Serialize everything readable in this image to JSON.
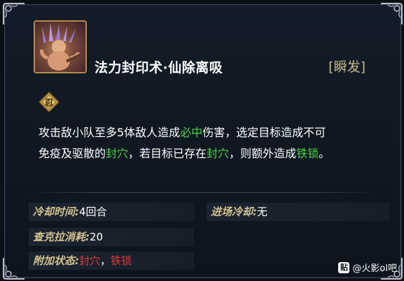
{
  "skill": {
    "name": "法力封印术·仙除离吸",
    "cast_type": "[瞬发]",
    "description": {
      "line1_pre": "攻击敌小队至多5体敌人造成",
      "line1_hl": "必中",
      "line1_post": "伤害，选定目标造成不可",
      "line2_pre": "免疫及驱散的",
      "line2_hl1": "封穴",
      "line2_mid": "，若目标已存在",
      "line2_hl2": "封穴",
      "line2_mid2": "，则额外造成",
      "line2_hl3": "铁锁",
      "line2_post": "。"
    }
  },
  "stats": {
    "cooldown": {
      "label": "冷却时间:",
      "value": "4回合"
    },
    "entry_cooldown": {
      "label": "进场冷却:",
      "value": "无"
    },
    "chakra_cost": {
      "label": "查克拉消耗:",
      "value": "20"
    },
    "extra_status": {
      "label": "附加状态:",
      "value1": "封穴",
      "sep": "，",
      "value2": "铁锁"
    }
  },
  "watermark": {
    "icon_text": "贴",
    "text": "@火影ol吧"
  },
  "colors": {
    "highlight_green": "#4fd24a",
    "highlight_red": "#e23b3b",
    "label_gold": "#d3c491"
  },
  "icons": {
    "skill_portrait": "skill-portrait-icon",
    "emblem": "seal-emblem-icon"
  }
}
